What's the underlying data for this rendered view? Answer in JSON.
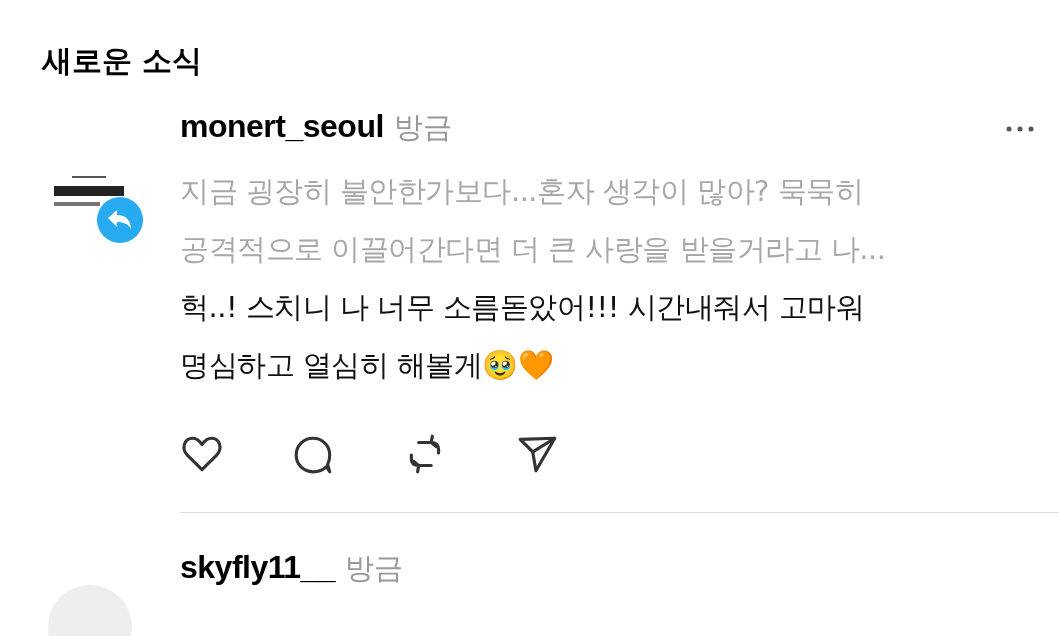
{
  "header": {
    "title": "새로운 소식"
  },
  "posts": [
    {
      "username": "monert_seoul",
      "time": "방금",
      "reply_badge": true,
      "quoted": [
        "지금 굉장히 불안한가보다...혼자 생각이 많아? 묵묵히",
        "공격적으로 이끌어간다면 더 큰 사랑을 받을거라고 나..."
      ],
      "body": [
        "헉..! 스치니 나 너무 소름돋았어!!! 시간내줘서 고마워",
        "명심하고 열심히 해볼게🥹🧡"
      ],
      "actions": true
    },
    {
      "username": "skyfly11__",
      "time": "방금",
      "avatar": {
        "kind": "blank"
      },
      "reply_badge": false,
      "actions": false
    }
  ]
}
